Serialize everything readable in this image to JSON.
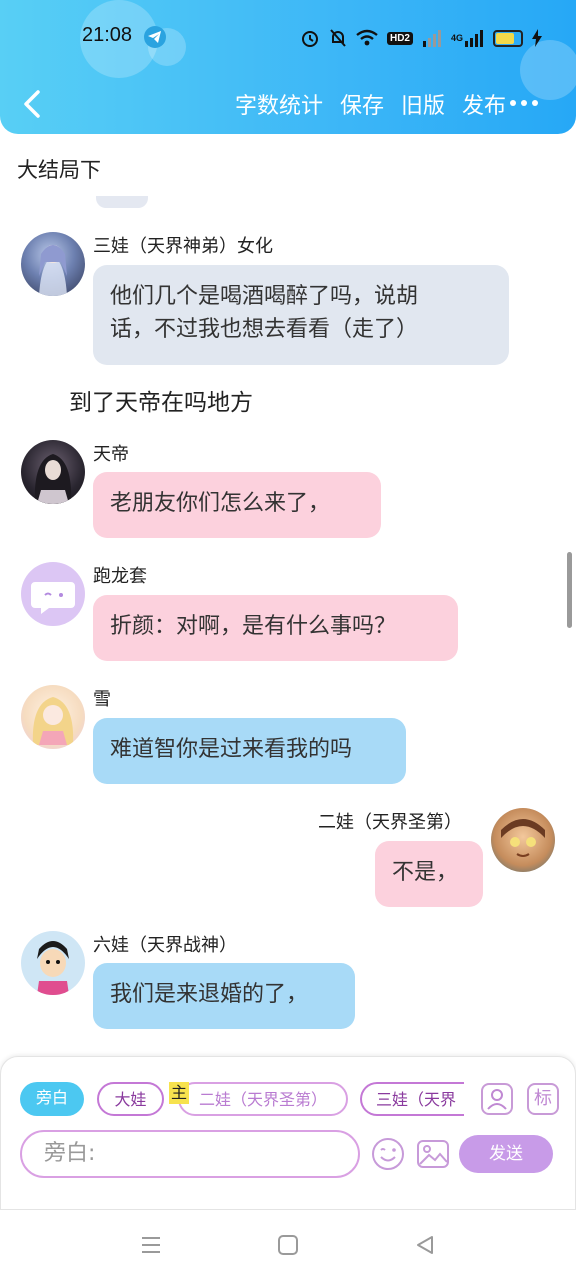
{
  "status_bar": {
    "time": "21:08",
    "network": "4G",
    "hd_label": "HD2"
  },
  "toolbar": {
    "menu": [
      "字数统计",
      "保存",
      "旧版",
      "发布"
    ]
  },
  "chapter_title": "大结局下",
  "narration": "到了天帝在吗地方",
  "messages": [
    {
      "name": "三娃（天界神弟）女化",
      "text_lines": [
        "他们几个是喝酒喝醉了吗，说胡",
        "话，不过我也想去看看（走了）"
      ]
    },
    {
      "name": "天帝",
      "text": "老朋友你们怎么来了，"
    },
    {
      "name": "跑龙套",
      "text": "折颜：对啊，是有什么事吗？"
    },
    {
      "name": "雪",
      "text": "难道智你是过来看我的吗"
    },
    {
      "name": "二娃（天界圣第）",
      "text": "不是，"
    },
    {
      "name": "六娃（天界战神）",
      "text": "我们是来退婚的了，"
    }
  ],
  "composer": {
    "roles": [
      "旁白",
      "大娃",
      "二娃（天界圣第）",
      "三娃（天界"
    ],
    "main_badge": "主",
    "mark_label": "标",
    "input_placeholder": "旁白:",
    "send_label": "发送"
  },
  "colors": {
    "header_start": "#58cff5",
    "header_end": "#26a8f6",
    "bubble_gray": "#e1e7f0",
    "bubble_pink": "#fcd1dd",
    "bubble_blue": "#a8daf7",
    "send_button": "#c89be8"
  }
}
